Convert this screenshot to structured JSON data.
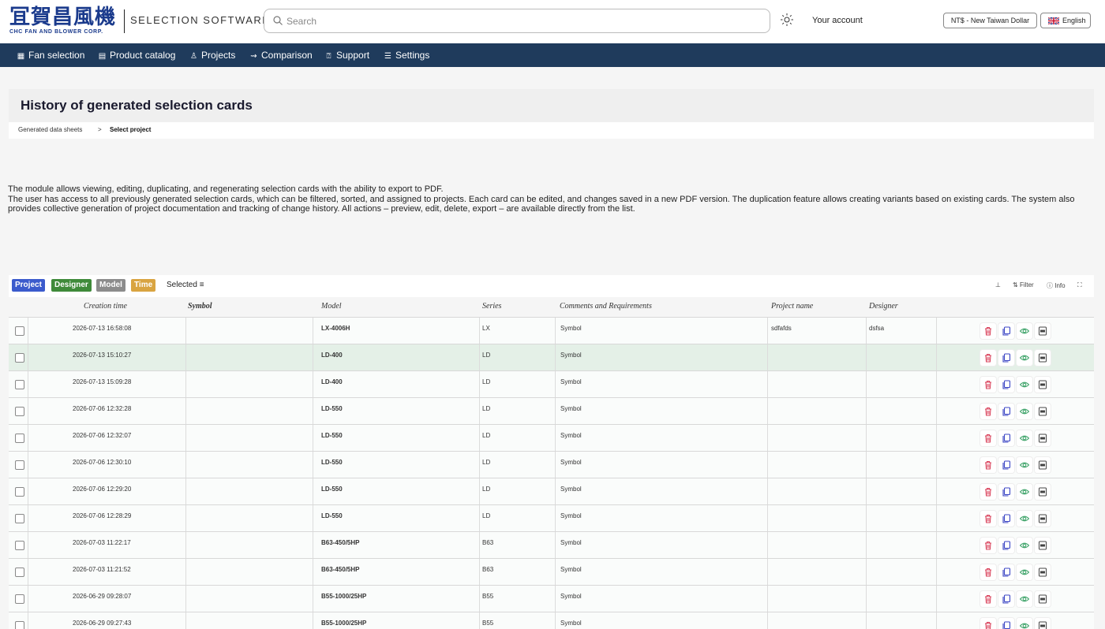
{
  "header": {
    "logo_cn": "冝賀昌風機",
    "logo_en": "CHC FAN AND BLOWER CORP.",
    "app_name": "SELECTION SOFTWARE",
    "search_placeholder": "Search",
    "account_label": "Your account",
    "currency_button": "NT$ - New Taiwan Dollar",
    "language_button": "English"
  },
  "nav": {
    "items": [
      {
        "label": "Fan selection",
        "icon": "grid-icon"
      },
      {
        "label": "Product catalog",
        "icon": "book-icon"
      },
      {
        "label": "Projects",
        "icon": "person-icon"
      },
      {
        "label": "Comparison",
        "icon": "compare-icon"
      },
      {
        "label": "Support",
        "icon": "help-icon"
      },
      {
        "label": "Settings",
        "icon": "sliders-icon"
      }
    ]
  },
  "page": {
    "title": "History of generated selection cards",
    "breadcrumb": [
      "Generated data sheets",
      "Select project"
    ],
    "breadcrumb_sep": ">",
    "description": [
      "The module allows viewing, editing, duplicating, and regenerating selection cards with the ability to export to PDF.",
      "The user has access to all previously generated selection cards, which can be filtered, sorted, and assigned to projects. Each card can be edited, and changes saved in a new PDF version. The duplication feature allows creating variants based on existing cards. The system also provides collective generation of project documentation and tracking of change history. All actions – preview, edit, delete, export – are available directly from the list."
    ]
  },
  "toolbar": {
    "chips": [
      {
        "label": "Project",
        "color": "#3b5bcc"
      },
      {
        "label": "Designer",
        "color": "#3f8a3a"
      },
      {
        "label": "Model",
        "color": "#8c8c8c"
      },
      {
        "label": "Time",
        "color": "#d9a441"
      }
    ],
    "selected_label": "Selected",
    "filter_label": "Filter",
    "info_label": "Info"
  },
  "table": {
    "columns": [
      "Creation time",
      "Symbol",
      "Model",
      "Series",
      "Comments and Requirements",
      "Project name",
      "Designer"
    ],
    "rows": [
      {
        "time": "2026-07-13 16:58:08",
        "symbol": "",
        "model": "LX-4006H",
        "series": "LX",
        "comments": "Symbol",
        "project": "sdfafds",
        "designer": "dsfsa",
        "highlight": false
      },
      {
        "time": "2026-07-13 15:10:27",
        "symbol": "",
        "model": "LD-400",
        "series": "LD",
        "comments": "Symbol",
        "project": "",
        "designer": "",
        "highlight": true
      },
      {
        "time": "2026-07-13 15:09:28",
        "symbol": "",
        "model": "LD-400",
        "series": "LD",
        "comments": "Symbol",
        "project": "",
        "designer": "",
        "highlight": false
      },
      {
        "time": "2026-07-06 12:32:28",
        "symbol": "",
        "model": "LD-550",
        "series": "LD",
        "comments": "Symbol",
        "project": "",
        "designer": "",
        "highlight": false
      },
      {
        "time": "2026-07-06 12:32:07",
        "symbol": "",
        "model": "LD-550",
        "series": "LD",
        "comments": "Symbol",
        "project": "",
        "designer": "",
        "highlight": false
      },
      {
        "time": "2026-07-06 12:30:10",
        "symbol": "",
        "model": "LD-550",
        "series": "LD",
        "comments": "Symbol",
        "project": "",
        "designer": "",
        "highlight": false
      },
      {
        "time": "2026-07-06 12:29:20",
        "symbol": "",
        "model": "LD-550",
        "series": "LD",
        "comments": "Symbol",
        "project": "",
        "designer": "",
        "highlight": false
      },
      {
        "time": "2026-07-06 12:28:29",
        "symbol": "",
        "model": "LD-550",
        "series": "LD",
        "comments": "Symbol",
        "project": "",
        "designer": "",
        "highlight": false
      },
      {
        "time": "2026-07-03 11:22:17",
        "symbol": "",
        "model": "B63-450/5HP",
        "series": "B63",
        "comments": "Symbol",
        "project": "",
        "designer": "",
        "highlight": false
      },
      {
        "time": "2026-07-03 11:21:52",
        "symbol": "",
        "model": "B63-450/5HP",
        "series": "B63",
        "comments": "Symbol",
        "project": "",
        "designer": "",
        "highlight": false
      },
      {
        "time": "2026-06-29 09:28:07",
        "symbol": "",
        "model": "B55-1000/25HP",
        "series": "B55",
        "comments": "Symbol",
        "project": "",
        "designer": "",
        "highlight": false
      },
      {
        "time": "2026-06-29 09:27:43",
        "symbol": "",
        "model": "B55-1000/25HP",
        "series": "B55",
        "comments": "Symbol",
        "project": "",
        "designer": "",
        "highlight": false
      }
    ],
    "action_icons": [
      "delete-icon",
      "duplicate-icon",
      "preview-icon",
      "pdf-icon"
    ],
    "action_colors": {
      "delete": "#d9405a",
      "duplicate": "#3b45c4",
      "preview": "#3fa46a",
      "pdf": "#444444"
    }
  }
}
